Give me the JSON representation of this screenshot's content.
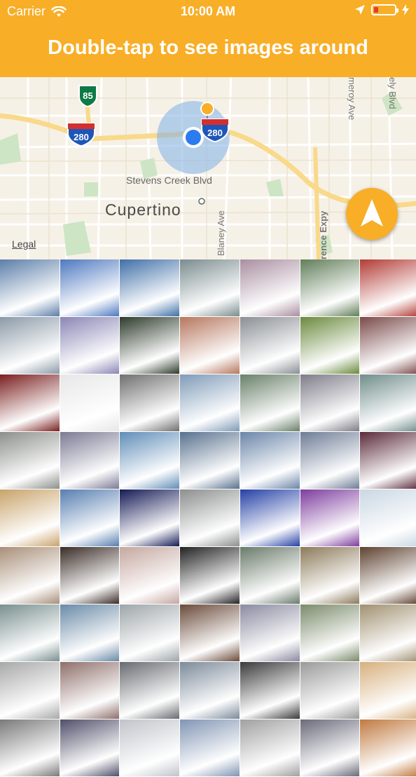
{
  "status_bar": {
    "carrier": "Carrier",
    "time": "10:00 AM",
    "battery_level": 0.2,
    "icons": [
      "wifi-icon",
      "location-arrow-icon",
      "battery-icon",
      "charging-bolt-icon"
    ]
  },
  "header": {
    "title": "Double-tap to see images around",
    "color": "#F8AE27"
  },
  "map": {
    "labels": {
      "city": "Cupertino",
      "street1": "Stevens Creek Blvd",
      "street2": "Blaney Ave",
      "street3": "rence Expy",
      "street4": "meroy Ave",
      "street5": "ely Blvd"
    },
    "shields": {
      "hwy85": "85",
      "i280_left": "280",
      "i280_right": "280"
    },
    "legal": "Legal",
    "compass_icon": "navigation-arrow-icon"
  },
  "photos": {
    "colors": [
      "#5b7ea8",
      "#4d78c0",
      "#3f6fa8",
      "#7a8c8f",
      "#a98fa0",
      "#617e59",
      "#b23b35",
      "#8c9aa7",
      "#8a86b5",
      "#2d3b2b",
      "#b6775e",
      "#8a8f94",
      "#6a8a3d",
      "#7a4a4a",
      "#7a1f1f",
      "#e7e7e7",
      "#6f6f6f",
      "#7f9bb8",
      "#69806a",
      "#7e7c88",
      "#6f8d8b",
      "#8b8f8a",
      "#7b7a94",
      "#5f8db8",
      "#58718d",
      "#6a85a8",
      "#6d7c95",
      "#5a2a3a",
      "#c9a36a",
      "#567eb0",
      "#151a55",
      "#8c8f8e",
      "#2440a5",
      "#7e3c9e",
      "#c9d7e3",
      "#a88f79",
      "#3a2c26",
      "#c5a7a0",
      "#222222",
      "#6a7a6a",
      "#8c7a5a",
      "#5e4230",
      "#7a8f8f",
      "#6a8aa6",
      "#9ea5a8",
      "#6a4a3a",
      "#8a8aa0",
      "#7a8a6a",
      "#a09070",
      "#a7a8a7",
      "#8e6f6a",
      "#676b70",
      "#7c8a9a",
      "#3a3a3a",
      "#9a9a9a",
      "#d7b07e",
      "#7a7a7a",
      "#4f4f6a",
      "#c0c4ca",
      "#8095b3",
      "#a0a0a0",
      "#6a6a7a",
      "#c07a40"
    ]
  }
}
